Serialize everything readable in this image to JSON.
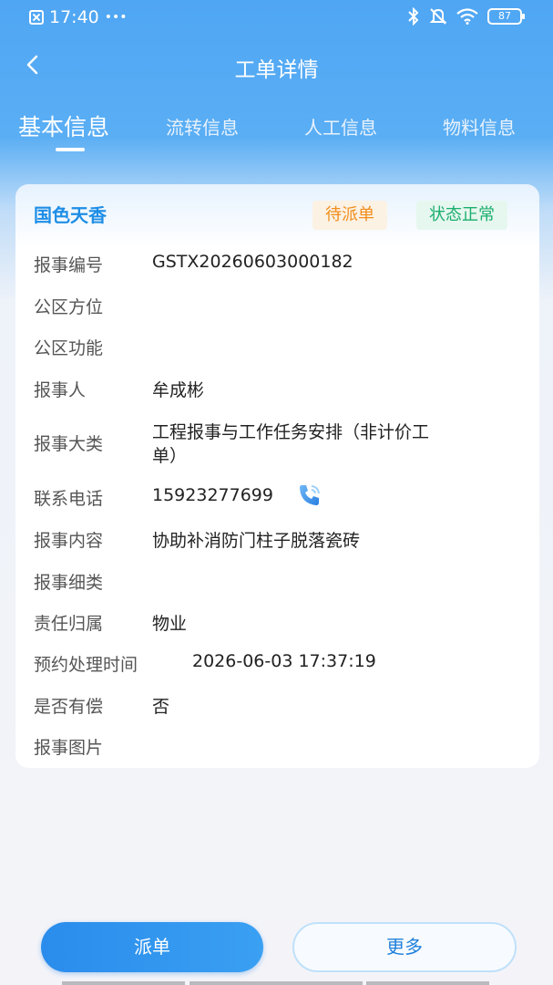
{
  "status_bar": {
    "time": "17:40",
    "dots": "•••",
    "battery": "87",
    "icons": [
      "sim-icon",
      "bluetooth-icon",
      "mute-bell-icon",
      "wifi-icon",
      "battery-icon"
    ]
  },
  "header": {
    "title": "工单详情",
    "back_icon": "chevron-left-icon"
  },
  "tabs": [
    {
      "label": "基本信息",
      "active": true
    },
    {
      "label": "流转信息",
      "active": false
    },
    {
      "label": "人工信息",
      "active": false
    },
    {
      "label": "物料信息",
      "active": false
    }
  ],
  "card": {
    "title": "国色天香",
    "badges": {
      "pending": "待派单",
      "normal": "状态正常"
    },
    "colors": {
      "accent": "#1e8ee6",
      "pending": "#f08d1c",
      "normal": "#1cae6e"
    },
    "fields": [
      {
        "label": "报事编号",
        "value": "GSTX20260603000182"
      },
      {
        "label": "公区方位",
        "value": ""
      },
      {
        "label": "公区功能",
        "value": ""
      },
      {
        "label": "报事人",
        "value": "牟成彬"
      },
      {
        "label": "报事大类",
        "value_line1": "工程报事与工作任务安排（非计价工",
        "value_line2": "单）"
      },
      {
        "label": "联系电话",
        "value": "15923277699",
        "icon": "phone-call-icon"
      },
      {
        "label": "报事内容",
        "value": "协助补消防门柱子脱落瓷砖"
      },
      {
        "label": "报事细类",
        "value": ""
      },
      {
        "label": "责任归属",
        "value": "物业"
      },
      {
        "label": "预约处理时间",
        "value": "2026-06-03 17:37:19"
      },
      {
        "label": "是否有偿",
        "value": "否"
      },
      {
        "label": "报事图片",
        "value": ""
      }
    ]
  },
  "actions": {
    "dispatch": "派单",
    "more": "更多"
  }
}
